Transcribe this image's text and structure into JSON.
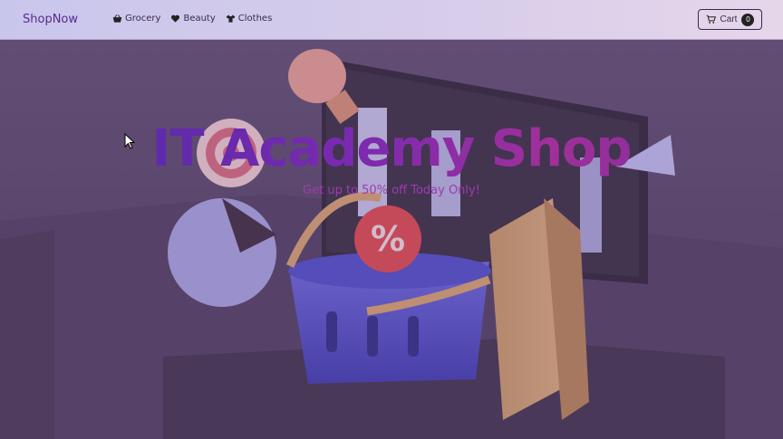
{
  "navbar": {
    "brand": "ShopNow",
    "links": [
      {
        "label": "Grocery",
        "icon": "basket-icon"
      },
      {
        "label": "Beauty",
        "icon": "heart-icon"
      },
      {
        "label": "Clothes",
        "icon": "shirt-icon"
      }
    ],
    "cart": {
      "label": "Cart",
      "count": "0",
      "icon": "cart-icon"
    }
  },
  "hero": {
    "title": "IT Academy Shop",
    "subtitle": "Get up to 50% off Today Only!",
    "badge_symbol": "%"
  },
  "colors": {
    "brand": "#5a2a8a",
    "title_gradient_start": "#4a2aa8",
    "title_gradient_end": "#a0309a",
    "subtitle": "#a03ab0"
  }
}
